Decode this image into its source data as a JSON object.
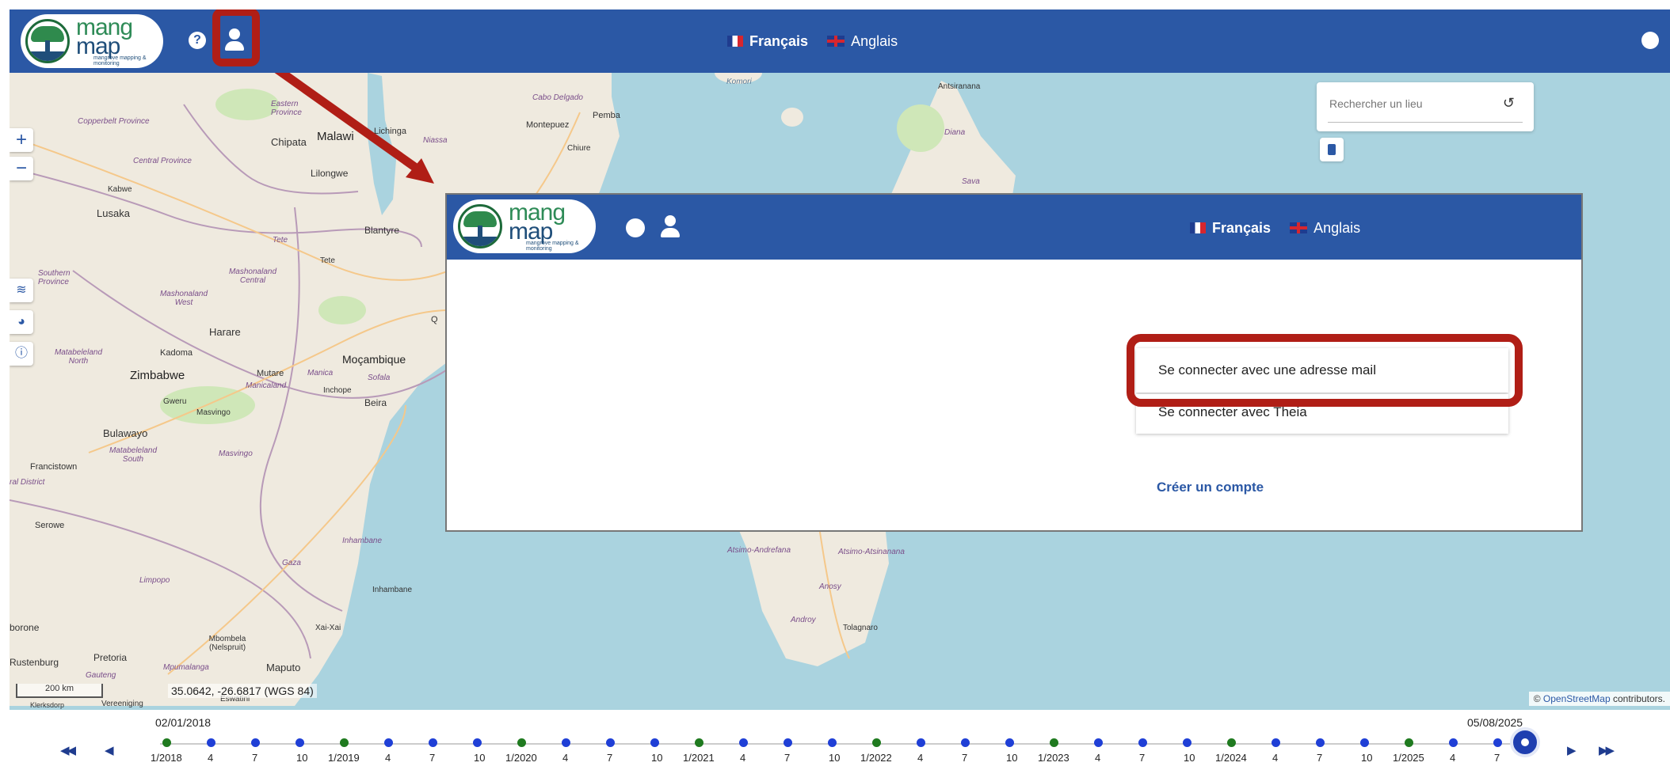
{
  "header": {
    "help_label": "?",
    "lang_fr": "Français",
    "lang_en": "Anglais",
    "icons": [
      "help-icon",
      "user-icon",
      "globe-icon"
    ]
  },
  "logo": {
    "word1": "mang",
    "word2": "map",
    "tagline": "mangrove mapping & monitoring"
  },
  "map_controls": {
    "zoom_in": "+",
    "zoom_out": "−"
  },
  "search": {
    "placeholder": "Rechercher un lieu"
  },
  "map_labels": {
    "komori": "Komori",
    "antsiranana": "Antsiranana",
    "cabo_delgado": "Cabo Delgado",
    "pemba": "Pemba",
    "montepuez": "Montepuez",
    "chiure": "Chiure",
    "lichinga": "Lichinga",
    "niassa": "Niassa",
    "copperbelt": "Copperbelt Province",
    "eastern": "Eastern Province",
    "chipata": "Chipata",
    "malawi": "Malawi",
    "lilongwe": "Lilongwe",
    "central_province": "Central Province",
    "kabwe": "Kabwe",
    "lusaka": "Lusaka",
    "diana": "Diana",
    "sava": "Sava",
    "blantyre": "Blantyre",
    "tete": "Tete",
    "tete_prov": "Tete",
    "southern": "Southern Province",
    "mash_central": "Mashonaland Central",
    "mash_west": "Mashonaland West",
    "harare": "Harare",
    "mat_north": "Matabeleland North",
    "kadoma": "Kadoma",
    "zimbabwe": "Zimbabwe",
    "mutare": "Mutare",
    "manicaland": "Manicaland",
    "manica": "Manica",
    "mocambique": "Moçambique",
    "sofala": "Sofala",
    "inchope": "Inchope",
    "beira": "Beira",
    "gweru": "Gweru",
    "masvingo": "Masvingo",
    "bulawayo": "Bulawayo",
    "mat_south": "Matabeleland South",
    "masvingo_prov": "Masvingo",
    "francistown": "Francistown",
    "ral_district": "ral District",
    "serowe": "Serowe",
    "inhambane_prov": "Inhambane",
    "gaza": "Gaza",
    "limpopo": "Limpopo",
    "inhambane": "Inhambane",
    "atsimo_andrefana": "Atsimo-Andrefana",
    "atsimo_atsinanana": "Atsimo-Atsinanana",
    "anosy": "Anosy",
    "androy": "Androy",
    "tolagnaro": "Tolagnaro",
    "borone": "borone",
    "xaixai": "Xai-Xai",
    "mbombela": "Mbombela (Nelspruit)",
    "rustenburg": "Rustenburg",
    "pretoria": "Pretoria",
    "gauteng": "Gauteng",
    "mpumalanga": "Mpumalanga",
    "maputo": "Maputo",
    "eswatini": "Eswatini",
    "klerksdorp": "Klerksdorp",
    "vereeniging": "Vereeniging",
    "q": "Q"
  },
  "inset": {
    "lang_fr": "Français",
    "lang_en": "Anglais",
    "signin_email": "Se connecter avec une adresse mail",
    "signin_theia": "Se connecter avec Theia",
    "create_account": "Créer un compte"
  },
  "map_footer": {
    "scale": "200 km",
    "coords": "35.0642, -26.6817 (WGS 84)",
    "attribution_prefix": "©",
    "attribution_link": "OpenStreetMap",
    "attribution_suffix": "contributors."
  },
  "timeline": {
    "start_date": "02/01/2018",
    "end_date": "05/08/2025",
    "ticks": [
      {
        "label": "1/2018",
        "year": true
      },
      {
        "label": "4"
      },
      {
        "label": "7"
      },
      {
        "label": "10"
      },
      {
        "label": "1/2019",
        "year": true
      },
      {
        "label": "4"
      },
      {
        "label": "7"
      },
      {
        "label": "10"
      },
      {
        "label": "1/2020",
        "year": true
      },
      {
        "label": "4"
      },
      {
        "label": "7"
      },
      {
        "label": "10"
      },
      {
        "label": "1/2021",
        "year": true
      },
      {
        "label": "4"
      },
      {
        "label": "7"
      },
      {
        "label": "10"
      },
      {
        "label": "1/2022",
        "year": true
      },
      {
        "label": "4"
      },
      {
        "label": "7"
      },
      {
        "label": "10"
      },
      {
        "label": "1/2023",
        "year": true
      },
      {
        "label": "4"
      },
      {
        "label": "7"
      },
      {
        "label": "10"
      },
      {
        "label": "1/2024",
        "year": true
      },
      {
        "label": "4"
      },
      {
        "label": "7"
      },
      {
        "label": "10"
      },
      {
        "label": "1/2025",
        "year": true
      },
      {
        "label": "4"
      },
      {
        "label": "7"
      }
    ],
    "colors": {
      "year_dot": "#1f7a1f",
      "month_dot": "#1f3fd6",
      "current": "#1f3fb0"
    }
  },
  "colors": {
    "header": "#2b58a5",
    "highlight": "#b01e16",
    "sea": "#aad3df",
    "land": "#efeadf"
  }
}
